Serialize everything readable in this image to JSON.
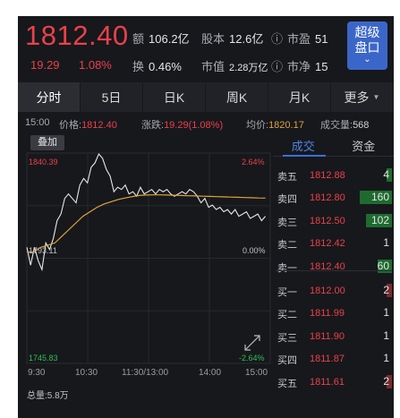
{
  "quote": {
    "price": "1812.40",
    "change": "19.29",
    "change_pct": "1.08%",
    "stats": [
      {
        "key": "额",
        "val": "106.2亿"
      },
      {
        "key": "股本",
        "val": "12.6亿"
      },
      {
        "key": "市盈",
        "val": "51"
      },
      {
        "key": "换",
        "val": "0.46%"
      },
      {
        "key": "市值",
        "val": "2.28万亿"
      },
      {
        "key": "市净",
        "val": "15"
      }
    ],
    "super_button": {
      "line1": "超级",
      "line2": "盘口"
    }
  },
  "tabs": [
    {
      "label": "分时",
      "active": true
    },
    {
      "label": "5日"
    },
    {
      "label": "日K"
    },
    {
      "label": "周K"
    },
    {
      "label": "月K"
    },
    {
      "label": "更多"
    }
  ],
  "info_row": {
    "time": "15:00",
    "price_label": "价格:",
    "price": "1812.40",
    "change_label": "涨跌:",
    "change": "19.29(1.08%)",
    "avg_label": "均价:",
    "avg": "1820.17",
    "volume_label": "成交量:",
    "volume": "568"
  },
  "overlay_label": "叠加",
  "chart_data": {
    "type": "line",
    "price_axis": {
      "high": "1840.39",
      "mid": "1793.11",
      "low": "1745.83"
    },
    "pct_axis": {
      "high": "2.64%",
      "mid": "0.00%",
      "low": "-2.64%"
    },
    "x_ticks": [
      "9:30",
      "10:30",
      "11:30/13:00",
      "14:00",
      "15:00"
    ],
    "ylim": [
      1745.83,
      1840.39
    ],
    "series": [
      {
        "values": [
          1798,
          1790,
          1798,
          1792,
          1788,
          1800,
          1797,
          1802,
          1810,
          1813,
          1820,
          1822,
          1820,
          1818,
          1826,
          1829,
          1827,
          1834,
          1836,
          1840,
          1838,
          1833,
          1830,
          1823,
          1825,
          1824,
          1826,
          1822,
          1823,
          1821,
          1825,
          1822,
          1823,
          1824,
          1822,
          1824,
          1823,
          1824,
          1822,
          1821,
          1822,
          1823,
          1822,
          1824,
          1823,
          1821,
          1818,
          1820,
          1816,
          1817,
          1815,
          1816,
          1814,
          1815,
          1813,
          1815,
          1812,
          1813,
          1814,
          1811,
          1812,
          1813,
          1810,
          1812
        ]
      },
      {
        "values": [
          1796,
          1796,
          1798,
          1799,
          1800,
          1803,
          1806,
          1809,
          1812,
          1814,
          1816,
          1817.5,
          1818.5,
          1819.5,
          1820.2,
          1820.8,
          1821.3,
          1821.5,
          1821.6,
          1821.6,
          1821.5,
          1821.4,
          1821.3,
          1821.2,
          1821.1,
          1821.0,
          1820.9,
          1820.8,
          1820.7,
          1820.6,
          1820.5,
          1820.4,
          1820.3,
          1820.2,
          1820.17
        ]
      }
    ]
  },
  "order_tabs": [
    {
      "label": "成交",
      "active": true
    },
    {
      "label": "资金"
    }
  ],
  "order_book": {
    "sell": [
      {
        "label": "卖五",
        "price": "1812.88",
        "vol": "4",
        "bar": 0.04
      },
      {
        "label": "卖四",
        "price": "1812.80",
        "vol": "160",
        "bar": 0.95
      },
      {
        "label": "卖三",
        "price": "1812.50",
        "vol": "102",
        "bar": 0.77
      },
      {
        "label": "卖二",
        "price": "1812.42",
        "vol": "1",
        "bar": 0.0
      },
      {
        "label": "卖一",
        "price": "1812.40",
        "vol": "60",
        "bar": 0.43
      }
    ],
    "buy": [
      {
        "label": "买一",
        "price": "1812.00",
        "vol": "2",
        "bar": 0.04
      },
      {
        "label": "买二",
        "price": "1811.99",
        "vol": "1",
        "bar": 0.0
      },
      {
        "label": "买三",
        "price": "1811.90",
        "vol": "1",
        "bar": 0.0
      },
      {
        "label": "买四",
        "price": "1811.87",
        "vol": "1",
        "bar": 0.0
      },
      {
        "label": "买五",
        "price": "1811.61",
        "vol": "2",
        "bar": 0.04
      }
    ]
  },
  "total_volume": "总量:5.8万",
  "colors": {
    "up": "#e9414a",
    "down": "#2fbf5a",
    "accent": "#3b66c9",
    "avg_line": "#e0a23a",
    "bg": "#17181c"
  }
}
